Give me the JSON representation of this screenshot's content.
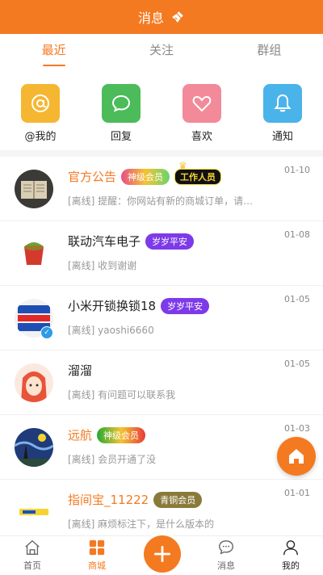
{
  "header": {
    "title": "消息"
  },
  "tabs": [
    {
      "label": "最近",
      "active": true
    },
    {
      "label": "关注",
      "active": false
    },
    {
      "label": "群组",
      "active": false
    }
  ],
  "quick_actions": [
    {
      "label": "@我的",
      "icon": "at-icon",
      "color": "#f5b731"
    },
    {
      "label": "回复",
      "icon": "chat-bubble-icon",
      "color": "#4cbb5a"
    },
    {
      "label": "喜欢",
      "icon": "heart-icon",
      "color": "#f28a9a"
    },
    {
      "label": "通知",
      "icon": "bell-icon",
      "color": "#4ab3ea"
    }
  ],
  "messages": [
    {
      "name": "官方公告",
      "name_color": "orange",
      "badge": "神级会员",
      "extra_badge": "工作人员",
      "preview": "[离线] 提醒：你网站有新的商城订单，请…",
      "time": "01-10"
    },
    {
      "name": "联动汽车电子",
      "badge": "岁岁平安",
      "preview": "[离线] 收到谢谢",
      "time": "01-08"
    },
    {
      "name": "小米开锁换锁18",
      "badge": "岁岁平安",
      "preview": "[离线] yaoshi6660",
      "time": "01-05"
    },
    {
      "name": "溜溜",
      "preview": "[离线] 有问题可以联系我",
      "time": "01-05"
    },
    {
      "name": "远航",
      "name_color": "orange",
      "badge": "神级会员",
      "preview": "[离线] 会员开通了没",
      "time": "01-03"
    },
    {
      "name": "指间宝_11222",
      "name_color": "orange",
      "badge": "青铜会员",
      "preview": "[离线] 麻烦标注下，是什么版本的",
      "time": "01-01"
    }
  ],
  "bottom_nav": [
    {
      "label": "首页"
    },
    {
      "label": "商城"
    },
    {
      "label": "消息"
    },
    {
      "label": "我的"
    }
  ],
  "colors": {
    "accent": "#f47a21"
  }
}
